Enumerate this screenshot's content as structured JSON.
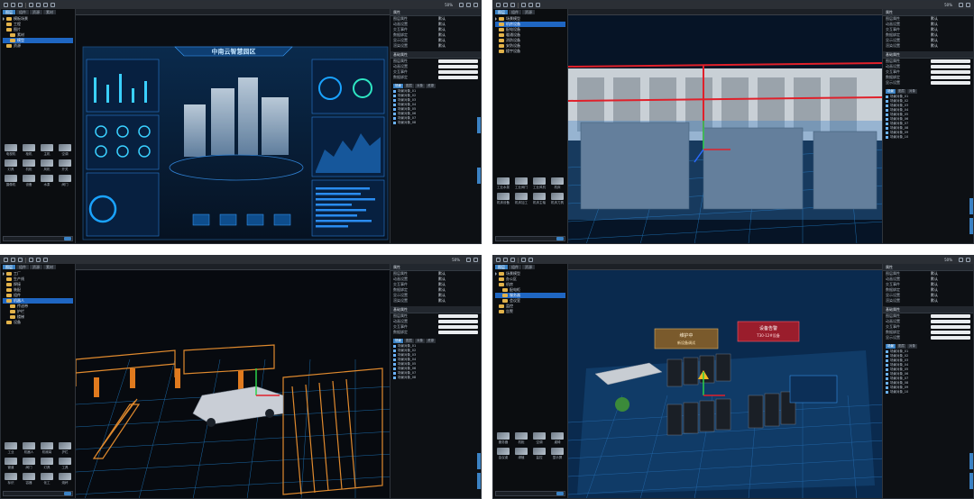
{
  "toolbar": {
    "zoom_label": "50%"
  },
  "left_tabs": [
    "图层",
    "组件",
    "资源",
    "素材"
  ],
  "panel1": {
    "tree": [
      "模板场景",
      "工程",
      "图片",
      "素材",
      "模型",
      "资源"
    ],
    "palette": [
      "电视机",
      "柜机",
      "主机",
      "空调",
      "灯具",
      "机柜",
      "风机",
      "开关",
      "摄像机",
      "设备",
      "水泵",
      "阀门"
    ]
  },
  "panel2": {
    "tree": [
      "场景模型",
      "机房设备",
      "配电设备",
      "暖通设备",
      "消防设备",
      "安防设备",
      "楼宇设备"
    ],
    "palette": [
      "工业水泵",
      "工业阀门",
      "工业风机",
      "机床",
      "机床设备",
      "机床加工",
      "机床主轴",
      "机床刀具"
    ]
  },
  "panel3": {
    "tree": [
      "工厂",
      "生产线",
      "焊接",
      "装配",
      "组件",
      "机器人",
      "传送带",
      "护栏",
      "楼梯",
      "设备"
    ],
    "palette": [
      "工业",
      "机器人",
      "机械臂",
      "护栏",
      "管道",
      "阀门",
      "灯具",
      "工具",
      "标识",
      "容器",
      "化工",
      "烧杯"
    ]
  },
  "panel4": {
    "tree": [
      "场景模型",
      "办公区",
      "机房",
      "配电柜",
      "服务器",
      "会议室",
      "监控",
      "告警"
    ],
    "palette": [
      "服务器",
      "机柜",
      "空调",
      "桌椅",
      "会议桌",
      "绿植",
      "监控",
      "显示屏"
    ],
    "label_maintenance": "维护中",
    "label_maintenance_sub": "新设备调试",
    "label_alarm": "设备告警",
    "label_alarm_sub": "T30-12#设备"
  },
  "dashboard": {
    "title": "中南云智慧园区"
  },
  "props": {
    "title": "属性",
    "rows": [
      "图层属性",
      "动画设置",
      "交互事件",
      "数据绑定",
      "显示设置",
      "渲染设置"
    ],
    "value": "默认",
    "section2": "基础属性",
    "tabs": [
      "场景",
      "图层",
      "对象",
      "资源"
    ]
  },
  "scene_items": [
    "场景对象_01",
    "场景对象_02",
    "场景对象_03",
    "场景对象_04",
    "场景对象_05",
    "场景对象_06",
    "场景对象_07",
    "场景对象_08",
    "场景对象_09",
    "场景对象_10"
  ],
  "colors": {
    "accent": "#3b82c4",
    "canvas_dark": "#061426",
    "grid": "#1c6aa8",
    "orange": "#e08a2e"
  }
}
